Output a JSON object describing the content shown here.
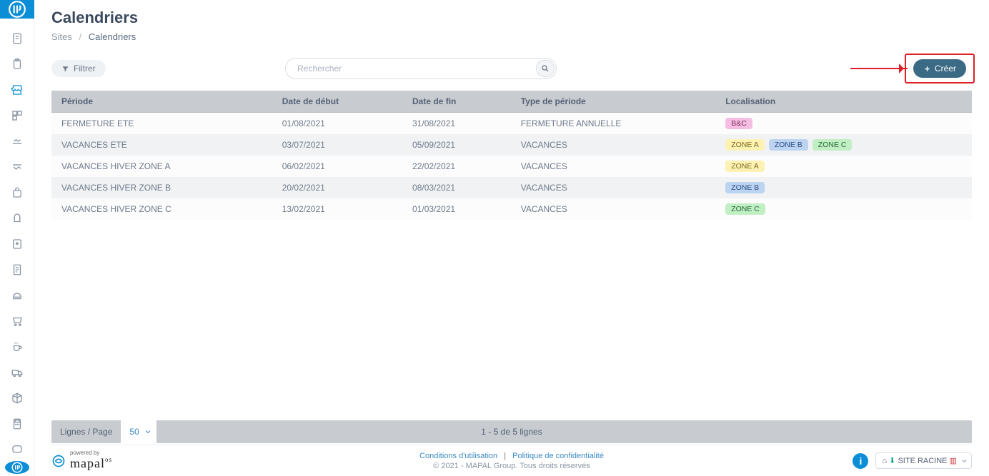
{
  "page_title": "Calendriers",
  "breadcrumb": {
    "root": "Sites",
    "current": "Calendriers"
  },
  "toolbar": {
    "filter_label": "Filtrer",
    "search_placeholder": "Rechercher",
    "create_label": "Créer"
  },
  "table": {
    "headers": {
      "periode": "Période",
      "debut": "Date de début",
      "fin": "Date de fin",
      "type": "Type de période",
      "localisation": "Localisation"
    },
    "rows": [
      {
        "periode": "FERMETURE ETE",
        "debut": "01/08/2021",
        "fin": "31/08/2021",
        "type": "FERMETURE ANNUELLE",
        "tags": [
          {
            "t": "B&C",
            "c": "pink"
          }
        ]
      },
      {
        "periode": "VACANCES ETE",
        "debut": "03/07/2021",
        "fin": "05/09/2021",
        "type": "VACANCES",
        "tags": [
          {
            "t": "ZONE A",
            "c": "yellow"
          },
          {
            "t": "ZONE B",
            "c": "blue"
          },
          {
            "t": "ZONE C",
            "c": "green"
          }
        ]
      },
      {
        "periode": "VACANCES HIVER ZONE A",
        "debut": "06/02/2021",
        "fin": "22/02/2021",
        "type": "VACANCES",
        "tags": [
          {
            "t": "ZONE A",
            "c": "yellow"
          }
        ]
      },
      {
        "periode": "VACANCES HIVER ZONE B",
        "debut": "20/02/2021",
        "fin": "08/03/2021",
        "type": "VACANCES",
        "tags": [
          {
            "t": "ZONE B",
            "c": "blue"
          }
        ]
      },
      {
        "periode": "VACANCES HIVER ZONE C",
        "debut": "13/02/2021",
        "fin": "01/03/2021",
        "type": "VACANCES",
        "tags": [
          {
            "t": "ZONE C",
            "c": "green"
          }
        ]
      }
    ]
  },
  "pagination": {
    "lpp_label": "Lignes / Page",
    "lpp_value": "50",
    "count_text": "1 - 5 de 5 lignes"
  },
  "footer": {
    "powered_by": "powered by",
    "brand": "mapal",
    "brand_suffix": "os",
    "terms": "Conditions d'utilisation",
    "privacy": "Politique de confidentialité",
    "copyright": "© 2021 - MAPAL Group. Tous droits réservés",
    "site_label": "SITE RACINE"
  }
}
